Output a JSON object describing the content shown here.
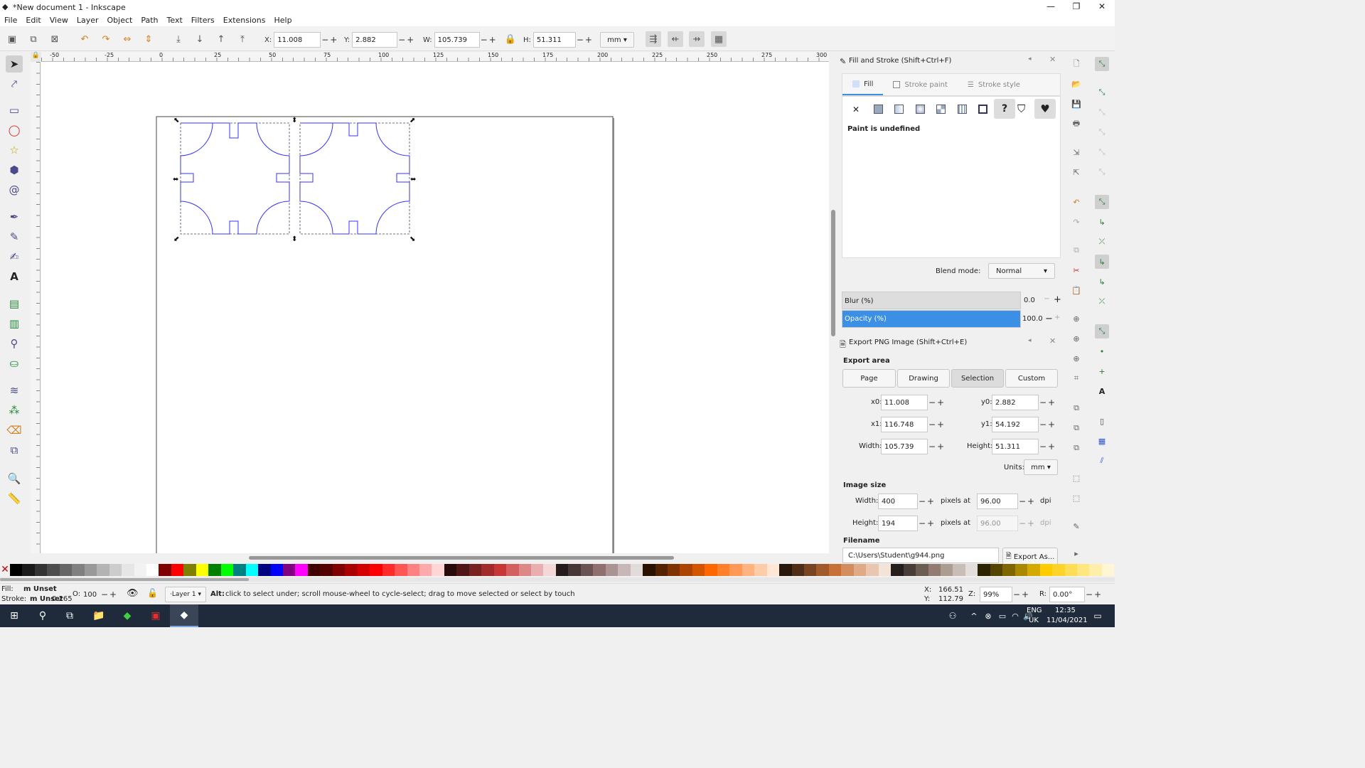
{
  "window": {
    "title": "*New document 1 - Inkscape",
    "controls": [
      "—",
      "❐",
      "✕"
    ]
  },
  "menu": [
    "File",
    "Edit",
    "View",
    "Layer",
    "Object",
    "Path",
    "Text",
    "Filters",
    "Extensions",
    "Help"
  ],
  "toolbar": {
    "x_label": "X:",
    "x_value": "11.008",
    "y_label": "Y:",
    "y_value": "2.882",
    "w_label": "W:",
    "w_value": "105.739",
    "h_label": "H:",
    "h_value": "51.311",
    "unit": "mm"
  },
  "ruler_ticks": [
    "-50",
    "-25",
    "0",
    "25",
    "50",
    "75",
    "100",
    "125",
    "150",
    "175",
    "200",
    "225",
    "250",
    "275",
    "300"
  ],
  "fill_stroke": {
    "title": "Fill and Stroke (Shift+Ctrl+F)",
    "tabs": [
      "Fill",
      "Stroke paint",
      "Stroke style"
    ],
    "status": "Paint is undefined",
    "blend_label": "Blend mode:",
    "blend_value": "Normal",
    "blur_label": "Blur (%)",
    "blur_value": "0.0",
    "opacity_label": "Opacity (%)",
    "opacity_value": "100.0",
    "opacity_level": 1.0
  },
  "export": {
    "title": "Export PNG Image (Shift+Ctrl+E)",
    "area_label": "Export area",
    "area_buttons": [
      "Page",
      "Drawing",
      "Selection",
      "Custom"
    ],
    "x0_label": "x0:",
    "x0": "11.008",
    "y0_label": "y0:",
    "y0": "2.882",
    "x1_label": "x1:",
    "x1": "116.748",
    "y1_label": "y1:",
    "y1": "54.192",
    "width_label": "Width:",
    "width": "105.739",
    "height_label": "Height:",
    "height": "51.311",
    "units_label": "Units:",
    "units": "mm",
    "image_size_label": "Image size",
    "img_width": "400",
    "img_height": "194",
    "pixels_at": "pixels at",
    "dpi": "96.00",
    "dpi2": "96.00",
    "dpi_label": "dpi",
    "filename_label": "Filename",
    "filename": "C:\\Users\\Student\\g944.png",
    "export_as": "Export As..."
  },
  "status": {
    "fill_label": "Fill:",
    "fill_value": "m Unset",
    "stroke_label": "Stroke:",
    "stroke_value": "m Unset",
    "stroke_width": "0.265",
    "opacity_label": "O:",
    "opacity_value": "100",
    "layer": "·Layer 1",
    "alt_label": "Alt:",
    "message": "click to select under; scroll mouse-wheel to cycle-select; drag to move selected or select by touch",
    "cx_label": "X:",
    "cx": "166.51",
    "cy_label": "Y:",
    "cy": "112.79",
    "zoom_label": "Z:",
    "zoom": "99%",
    "rot_label": "R:",
    "rotation": "0.00°"
  },
  "taskbar": {
    "lang1": "ENG",
    "lang2": "UK",
    "time": "12:35",
    "date": "11/04/2021"
  },
  "palette": [
    "#000000",
    "#1a1a1a",
    "#333333",
    "#4d4d4d",
    "#666666",
    "#808080",
    "#999999",
    "#b3b3b3",
    "#cccccc",
    "#e6e6e6",
    "#f2f2f2",
    "#ffffff",
    "#800000",
    "#ff0000",
    "#808000",
    "#ffff00",
    "#008000",
    "#00ff00",
    "#008080",
    "#00ffff",
    "#000080",
    "#0000ff",
    "#800080",
    "#ff00ff",
    "#400000",
    "#550000",
    "#800000",
    "#aa0000",
    "#d40000",
    "#ff0000",
    "#ff2a2a",
    "#ff5555",
    "#ff8080",
    "#ffaaaa",
    "#ffd5d5",
    "#280b0b",
    "#501616",
    "#782121",
    "#a02c2c",
    "#c83737",
    "#d35f5f",
    "#de8787",
    "#e9afaf",
    "#f4d7d7",
    "#241c1c",
    "#483737",
    "#6c5353",
    "#916f6f",
    "#ac9393",
    "#c8b7b7",
    "#e3dbdb",
    "#2b1100",
    "#552200",
    "#803300",
    "#aa4400",
    "#d45500",
    "#ff6600",
    "#ff7f2a",
    "#ff9955",
    "#ffb380",
    "#ffccaa",
    "#ffe6d5",
    "#28170b",
    "#502d16",
    "#784421",
    "#a05a2c",
    "#c87137",
    "#d38d5f",
    "#deaa87",
    "#e9c6af",
    "#f4e3d7",
    "#241f1c",
    "#483e37",
    "#6c5d53",
    "#917c6f",
    "#ac9d93",
    "#c8beb7",
    "#e3dedb",
    "#2b2200",
    "#554400",
    "#806600",
    "#aa8800",
    "#d4aa00",
    "#ffcc00",
    "#ffd42a",
    "#ffdd55",
    "#ffe680",
    "#ffeeaa",
    "#fff6d5"
  ]
}
